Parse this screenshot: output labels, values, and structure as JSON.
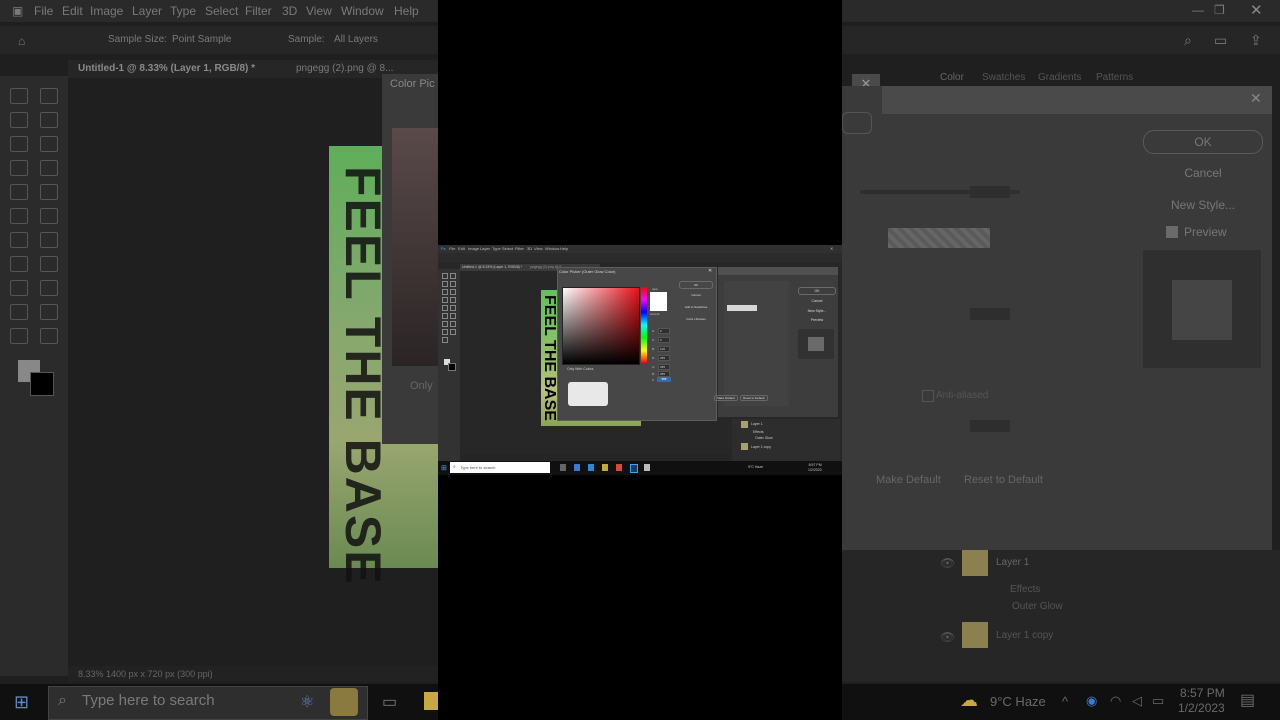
{
  "backdrop_left": {
    "menu": [
      "File",
      "Edit",
      "Image",
      "Layer",
      "Type",
      "Select",
      "Filter",
      "3D",
      "View",
      "Window",
      "Help"
    ],
    "options": {
      "sample_size": "Sample Size:",
      "point_sample": "Point Sample",
      "sample": "Sample:",
      "all_layers": "All Layers"
    },
    "doc_tab": "Untitled-1 @ 8.33% (Layer 1, RGB/8) *",
    "doc_tab_2": "pngegg (2).png @ 8...",
    "dialog_title": "Color Pic",
    "only_web": "Only",
    "canvas_text": "FEEL THE BASE",
    "status": "8.33%     1400 px x 720 px (300 ppi)",
    "search_text": "Type here to search"
  },
  "backdrop_right": {
    "tabs": [
      "Color",
      "Swatches",
      "Gradients",
      "Patterns"
    ],
    "buttons": {
      "ok": "OK",
      "cancel": "Cancel",
      "new_style": "New Style...",
      "preview": "Preview"
    },
    "make_default": "Make Default",
    "reset_to_default": "Reset to Default",
    "anti_aliased": "Anti-aliased",
    "layers": [
      {
        "name": "Layer 1"
      },
      {
        "name": "Effects"
      },
      {
        "name": "Outer Glow"
      },
      {
        "name": "Layer 1 copy"
      }
    ],
    "weather": "9°C  Haze",
    "time": "8:57 PM",
    "date": "1/2/2023"
  },
  "screen": {
    "menu": [
      "Ps",
      "File",
      "Edit",
      "Image",
      "Layer",
      "Type",
      "Select",
      "Filter",
      "3D",
      "View",
      "Window",
      "Help"
    ],
    "doc_tab": "Untitled-1 @ 8.33% (Layer 1, RGB/8) *",
    "doc_tab_2": "pngegg (2).png @ 8...",
    "canvas_text": "FEEL THE BASE",
    "color_picker": {
      "title": "Color Picker (Outer Glow Color)",
      "label_new": "new",
      "label_current": "current",
      "buttons": {
        "ok": "OK",
        "cancel": "Cancel",
        "add_to_swatches": "Add to Swatches",
        "color_libraries": "Color Libraries"
      },
      "only_web_colors": "Only Web Colors",
      "fields": [
        "H:",
        "S:",
        "B:",
        "R:",
        "G:",
        "B:"
      ],
      "values": [
        "0",
        "0",
        "100",
        "255",
        "255",
        "255"
      ],
      "hex_label": "#",
      "hex": "ffffff"
    },
    "layer_style": {
      "buttons": {
        "ok": "OK",
        "cancel": "Cancel",
        "new_style": "New Style...",
        "preview": "Preview"
      },
      "make_default": "Make Default",
      "reset_to_default": "Reset to Default"
    },
    "layers": [
      "Layer 1",
      "Effects",
      "Outer Glow",
      "Layer 1 copy"
    ],
    "search": "Type here to search",
    "weather": "9°C  Haze",
    "time": "8:57 PM",
    "date": "1/2/2023"
  },
  "colors": {
    "accent": "#2f6cb3",
    "bg_dark": "#272727",
    "panel": "#474747",
    "canvas_green": "#62c15b"
  }
}
